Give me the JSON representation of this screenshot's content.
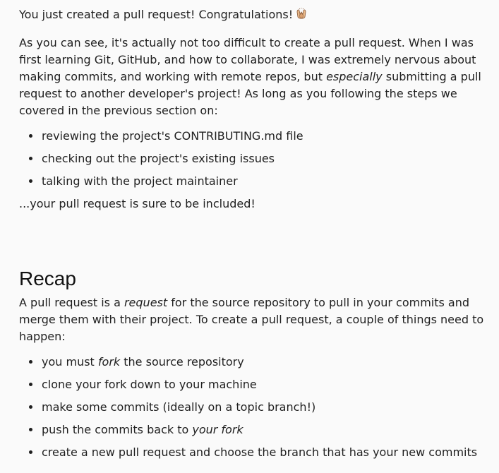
{
  "intro": {
    "text": "You just created a pull request! Congratulations!",
    "emoji_icon": "raising-hands-emoji"
  },
  "para1": {
    "part1": "As you can see, it's actually not too difficult to create a pull request. When I was first learning Git, GitHub, and how to collaborate, I was extremely nervous about making commits, and working with remote repos, but ",
    "em": "especially",
    "part2": " submitting a pull request to another developer's project! As long as you following the steps we covered in the previous section on:"
  },
  "steps_list": [
    "reviewing the project's CONTRIBUTING.md file",
    "checking out the project's existing issues",
    "talking with the project maintainer"
  ],
  "after_list": "...your pull request is sure to be included!",
  "recap": {
    "heading": "Recap",
    "text_part1": "A pull request is a ",
    "text_em": "request",
    "text_part2": " for the source repository to pull in your commits and merge them with their project. To create a pull request, a couple of things need to happen:",
    "items": [
      {
        "before": "you must ",
        "em": "fork",
        "after": " the source repository"
      },
      {
        "before": "clone your fork down to your machine",
        "em": "",
        "after": ""
      },
      {
        "before": "make some commits (ideally on a topic branch!)",
        "em": "",
        "after": ""
      },
      {
        "before": "push the commits back to ",
        "em": "your fork",
        "after": ""
      },
      {
        "before": "create a new pull request and choose the branch that has your new commits",
        "em": "",
        "after": ""
      }
    ]
  }
}
